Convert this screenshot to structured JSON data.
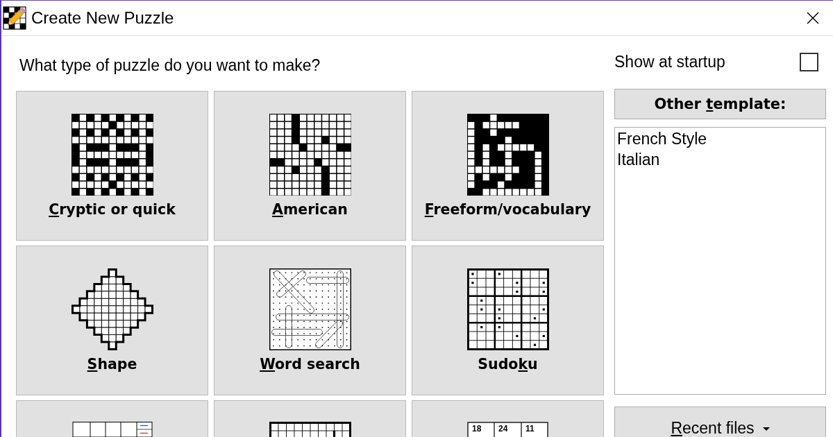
{
  "window": {
    "title": "Create New Puzzle"
  },
  "prompt": "What type of puzzle do you want to make?",
  "puzzle_types": [
    {
      "kind": "cryptic",
      "label": {
        "access_key": "C",
        "text_after": "ryptic or quick"
      }
    },
    {
      "kind": "american",
      "label": {
        "access_key": "A",
        "text_after": "merican"
      }
    },
    {
      "kind": "freeform",
      "label": {
        "access_key": "F",
        "text_after": "reeform/vocabulary"
      }
    },
    {
      "kind": "shape",
      "label": {
        "access_key": "S",
        "text_after": "hape"
      }
    },
    {
      "kind": "wordsearch",
      "label": {
        "access_key": "W",
        "text_after": "ord search"
      }
    },
    {
      "kind": "sudoku",
      "label": {
        "text_before": "Sudo",
        "access_key": "k",
        "text_after": "u"
      }
    },
    {
      "kind": "cluegrid"
    },
    {
      "kind": "barred"
    },
    {
      "kind": "numbergrid",
      "grid_numbers": [
        "18",
        "24",
        "11"
      ]
    }
  ],
  "show_at_startup": {
    "label": "Show at startup",
    "checked": false
  },
  "other_template_button": {
    "text_before": "Other ",
    "access_key": "t",
    "text_after": "emplate:"
  },
  "templates": [
    {
      "label": "French Style",
      "selected": false
    },
    {
      "label": "Italian",
      "selected": false
    }
  ],
  "recent_files_button": {
    "access_key": "R",
    "text_after": "ecent files"
  }
}
